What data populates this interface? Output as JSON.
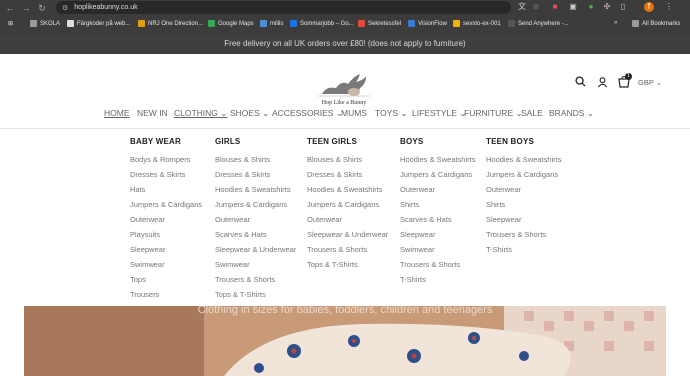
{
  "browser": {
    "url": "hoplikeabunny.co.uk",
    "bookmarks": [
      {
        "label": "SKOLA",
        "color": "#8a8a8a"
      },
      {
        "label": "Färgkoder på web...",
        "color": "#2a2a2a"
      },
      {
        "label": "NRJ One Direction...",
        "color": "#e0a000"
      },
      {
        "label": "Google Maps",
        "color": "#34a853"
      },
      {
        "label": "millis",
        "color": "#4a90d9"
      },
      {
        "label": "Sommarjobb – Go...",
        "color": "#1a73e8"
      },
      {
        "label": "Sekretessfel",
        "color": "#e54a3a"
      },
      {
        "label": "VisionFlow",
        "color": "#3a7bd5"
      },
      {
        "label": "sevsto-ex-001",
        "color": "#f0b400"
      },
      {
        "label": "Send Anywhere -...",
        "color": "#444"
      }
    ],
    "all_bookmarks": "All Bookmarks",
    "profile_initial": "f"
  },
  "announcement": "Free delivery on all UK orders over £80! (does not apply to furniture)",
  "header": {
    "logo_text": "Hop Like a Bunny",
    "currency": "GBP",
    "cart_count": "1"
  },
  "nav": [
    "HOME",
    "NEW IN",
    "CLOTHING",
    "SHOES",
    "ACCESSORIES",
    "MUMS",
    "TOYS",
    "LIFESTYLE",
    "FURNITURE",
    "SALE",
    "BRANDS"
  ],
  "mega_menu": [
    {
      "title": "BABY WEAR",
      "items": [
        "Bodys & Rompers",
        "Dresses & Skirts",
        "Hats",
        "Jumpers & Cardigans",
        "Outerwear",
        "Playsuits",
        "Sleepwear",
        "Swimwear",
        "Tops",
        "Trousers"
      ]
    },
    {
      "title": "GIRLS",
      "items": [
        "Blouses & Shirts",
        "Dresses & Skirts",
        "Hoodies & Sweatshirts",
        "Jumpers & Cardigans",
        "Outerwear",
        "Scarves & Hats",
        "Sleepwear & Underwear",
        "Swimwear",
        "Trousers & Shorts",
        "Tops & T-Shirts"
      ]
    },
    {
      "title": "TEEN GIRLS",
      "items": [
        "Blouses & Shirts",
        "Dresses & Skirts",
        "Hoodies & Sweatshirts",
        "Jumpers & Cardigans",
        "Outerwear",
        "Sleepwear & Underwear",
        "Trousers & Shorts",
        "Tops & T-Shirts"
      ]
    },
    {
      "title": "BOYS",
      "items": [
        "Hoodies & Sweatshirts",
        "Jumpers & Cardigans",
        "Outerwear",
        "Shirts",
        "Scarves & Hats",
        "Sleepwear",
        "Swimwear",
        "Trousers & Shorts",
        "T-Shirts"
      ]
    },
    {
      "title": "TEEN BOYS",
      "items": [
        "Hoodies & Sweatshirts",
        "Jumpers & Cardigans",
        "Outerwear",
        "Shirts",
        "Sleepwear",
        "Trousers & Shorts",
        "T-Shirts"
      ]
    }
  ],
  "hero": {
    "tagline": "Clothing in sizes for babies, toddlers, children and teenagers"
  }
}
